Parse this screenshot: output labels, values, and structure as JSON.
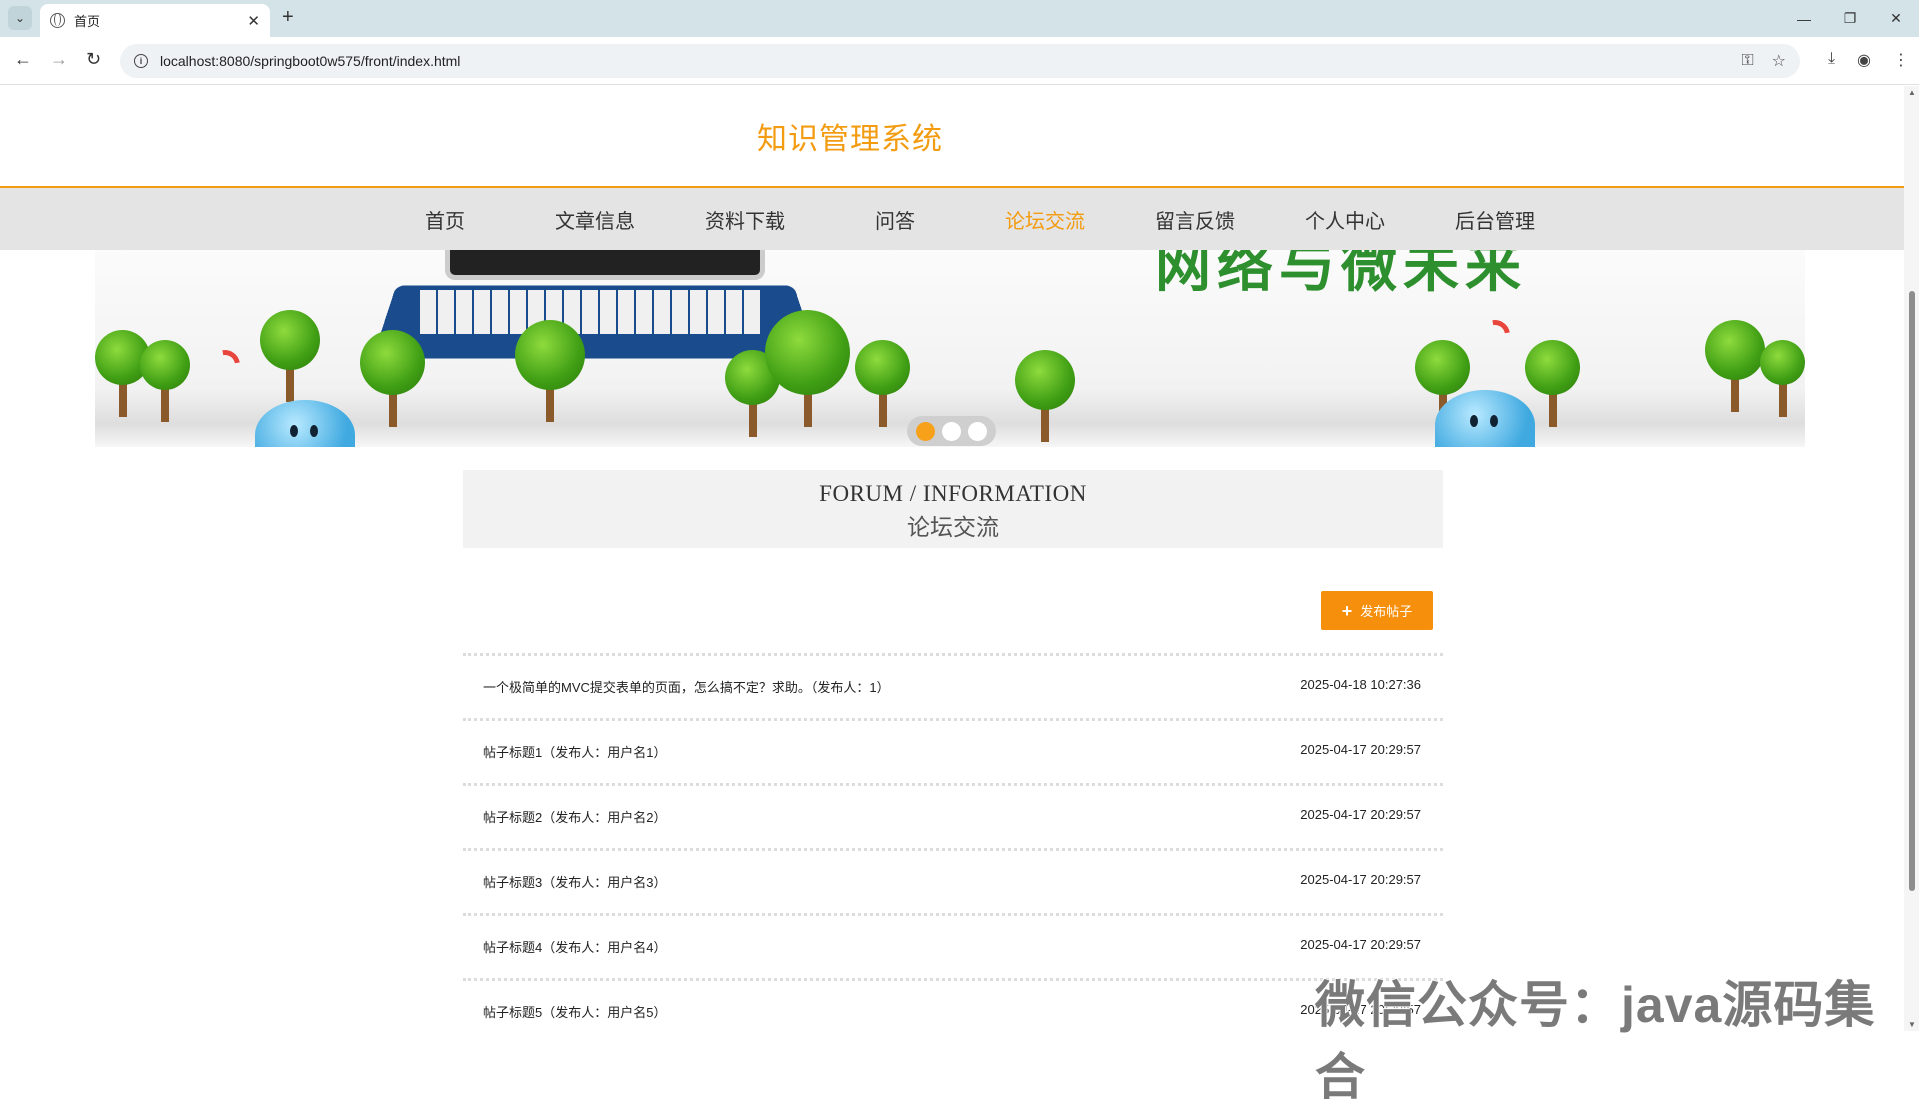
{
  "browser": {
    "tab_title": "首页",
    "url": "localhost:8080/springboot0w575/front/index.html"
  },
  "site": {
    "title": "知识管理系统"
  },
  "nav": {
    "items": [
      "首页",
      "文章信息",
      "资料下载",
      "问答",
      "论坛交流",
      "留言反馈",
      "个人中心",
      "后台管理"
    ],
    "active": "论坛交流"
  },
  "banner": {
    "text": "网络与微未来",
    "slides": 3,
    "active_slide": 1
  },
  "section": {
    "title_en": "FORUM / INFORMATION",
    "title_cn": "论坛交流"
  },
  "actions": {
    "post_label": "发布帖子"
  },
  "posts": [
    {
      "title": "一个极简单的MVC提交表单的页面，怎么搞不定？求助。（发布人：1）",
      "date": "2025-04-18 10:27:36"
    },
    {
      "title": "帖子标题1（发布人：用户名1）",
      "date": "2025-04-17 20:29:57"
    },
    {
      "title": "帖子标题2（发布人：用户名2）",
      "date": "2025-04-17 20:29:57"
    },
    {
      "title": "帖子标题3（发布人：用户名3）",
      "date": "2025-04-17 20:29:57"
    },
    {
      "title": "帖子标题4（发布人：用户名4）",
      "date": "2025-04-17 20:29:57"
    },
    {
      "title": "帖子标题5（发布人：用户名5）",
      "date": "2025-04-17 20:29:57"
    }
  ],
  "watermark": "微信公众号：java源码集合",
  "colors": {
    "accent": "#f39c12",
    "button": "#f6900c",
    "nav_bg": "#e4e4e4"
  }
}
